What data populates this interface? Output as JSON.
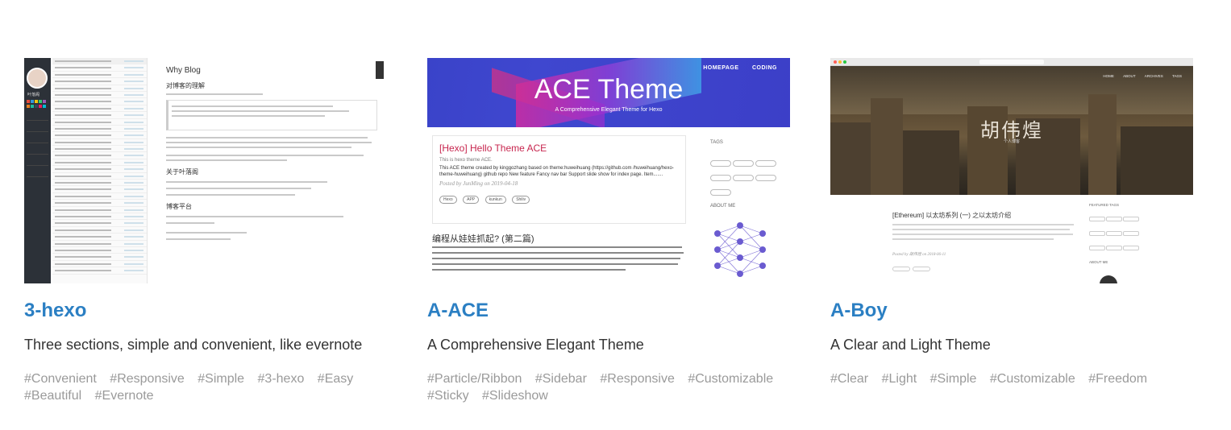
{
  "themes": [
    {
      "name": "3-hexo",
      "description": "Three sections, simple and convenient, like evernote",
      "tags": [
        "#Convenient",
        "#Responsive",
        "#Simple",
        "#3-hexo",
        "#Easy",
        "#Beautiful",
        "#Evernote"
      ],
      "preview": {
        "article_title": "Why Blog",
        "heading_1": "对博客的理解",
        "heading_2": "关于叶落阁",
        "heading_3": "博客平台",
        "side_name": "叶落阁"
      }
    },
    {
      "name": "A-ACE",
      "description": "A Comprehensive Elegant Theme",
      "tags": [
        "#Particle/Ribbon",
        "#Sidebar",
        "#Responsive",
        "#Customizable",
        "#Sticky",
        "#Slideshow"
      ],
      "preview": {
        "nav": [
          "HOMEPAGE",
          "CODING"
        ],
        "banner_title": "ACE Theme",
        "banner_subtitle": "A Comprehensive Elegant Theme for Hexo",
        "post_title": "[Hexo] Hello Theme ACE",
        "post_subtitle": "This is hexo theme ACE.",
        "post_body": "This ACE theme created by kinggozhang based on theme:huweihuang (https://github.com /huweihuang/hexo-theme-huweihuang) github repo New feature Fancy nav bar Support slide show for index page. Item.......",
        "post_meta": "Posted by JunMing on 2019-04-18",
        "post_pills": [
          "Hexo",
          "APP",
          "kunkun",
          "Shiliv"
        ],
        "post2_title": "编程从娃娃抓起? (第二篇)",
        "side_tags_heading": "TAGS",
        "side_about_heading": "ABOUT ME"
      }
    },
    {
      "name": "A-Boy",
      "description": "A Clear and Light Theme",
      "tags": [
        "#Clear",
        "#Light",
        "#Simple",
        "#Customizable",
        "#Freedom"
      ],
      "preview": {
        "hero_name": "胡伟煌",
        "hero_sub": "个人博客",
        "nav": [
          "HOME",
          "ABOUT",
          "ARCHIVES",
          "TAGS"
        ],
        "post_title": "[Ethereum] 以太坊系列 (一) 之以太坊介绍",
        "post_meta": "Posted by 胡伟煌 on 2018-06-11",
        "featured_tags_heading": "FEATURED TAGS",
        "about_heading": "ABOUT ME"
      }
    }
  ]
}
